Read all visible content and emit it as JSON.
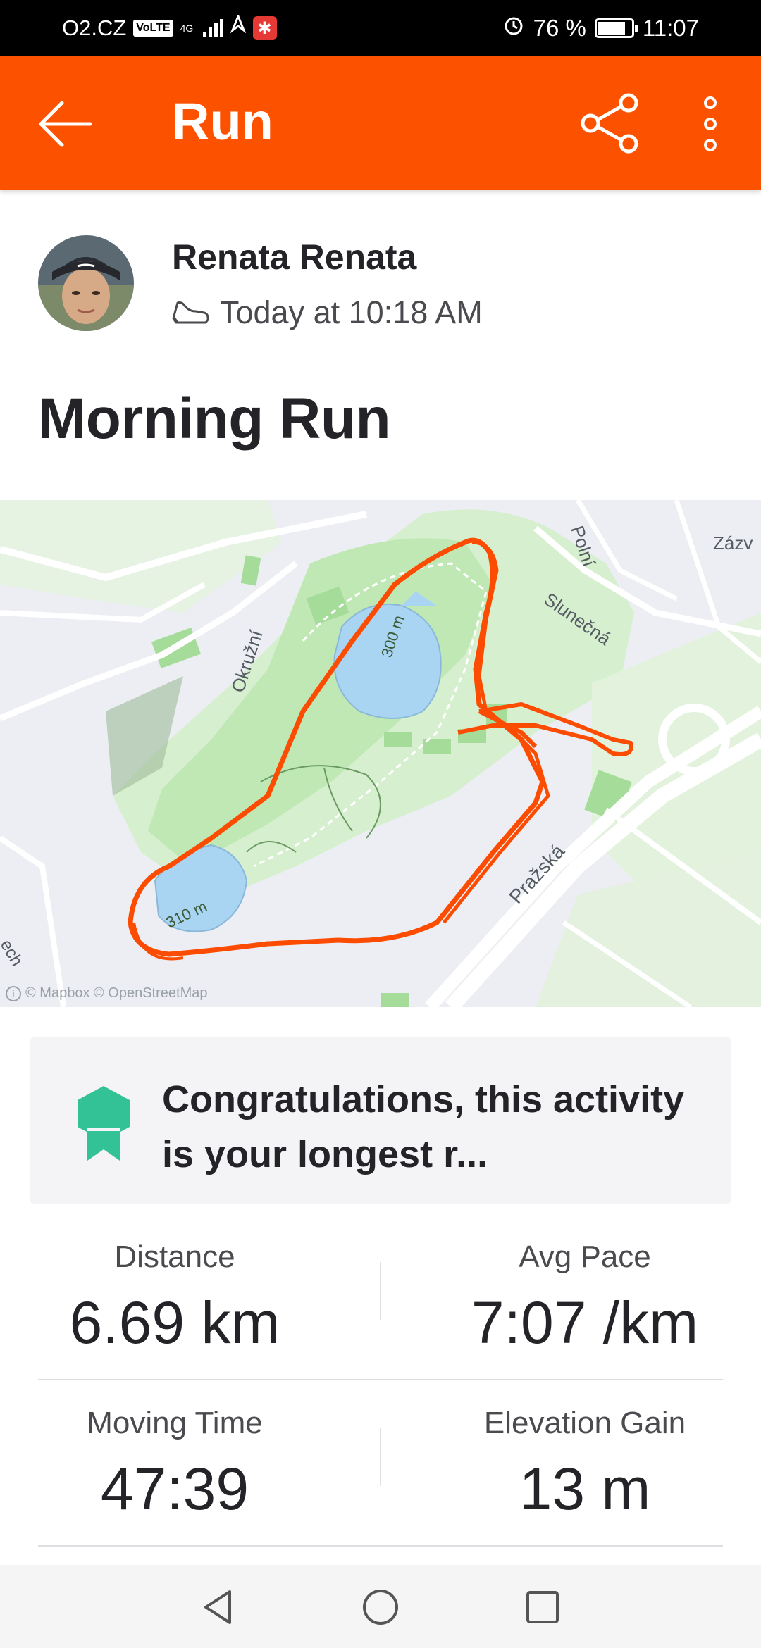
{
  "status_bar": {
    "carrier": "O2.CZ",
    "volte": "VoLTE",
    "network": "4G",
    "battery": "76 %",
    "time": "11:07"
  },
  "app_bar": {
    "title": "Run"
  },
  "activity": {
    "athlete_name": "Renata Renata",
    "date": "Today at 10:18 AM",
    "title": "Morning Run"
  },
  "map": {
    "labels": {
      "polni": "Polní",
      "slunecna": "Slunečná",
      "zazv": "Zázv",
      "okruzni": "Okružní",
      "prazska": "Pražská",
      "m300": "300 m",
      "m310": "310 m",
      "edge": "ech"
    },
    "attribution": "© Mapbox © OpenStreetMap",
    "info_glyph": "i"
  },
  "achievement": {
    "text": "Congratulations, this activity is your longest r..."
  },
  "stats": {
    "distance_label": "Distance",
    "distance_value": "6.69 km",
    "pace_label": "Avg Pace",
    "pace_value": "7:07 /km",
    "moving_time_label": "Moving Time",
    "moving_time_value": "47:39",
    "elevation_label": "Elevation Gain",
    "elevation_value": "13 m"
  },
  "colors": {
    "brand": "#fc5200",
    "route": "#fc4c02",
    "park": "#bfe8b4",
    "water": "#a9d4f2",
    "medal": "#33c296"
  },
  "icons": {
    "back": "arrow-left-icon",
    "share": "share-icon",
    "more": "more-vertical-icon",
    "shoe": "shoe-icon",
    "medal": "achievement-medal-icon",
    "nav_back": "triangle-back-icon",
    "nav_home": "circle-home-icon",
    "nav_recents": "square-recents-icon"
  }
}
